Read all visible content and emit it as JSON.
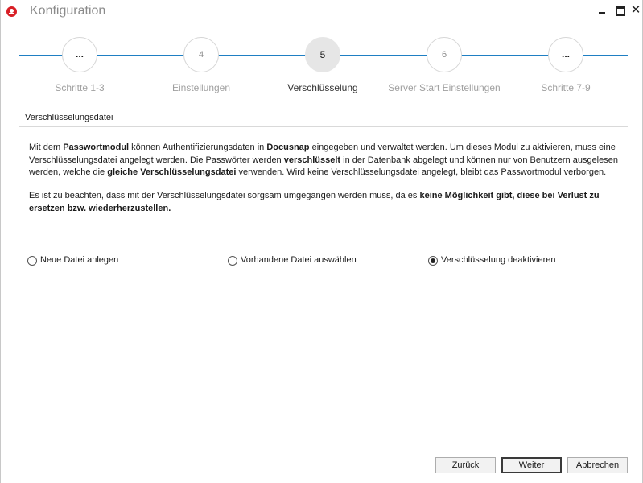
{
  "window": {
    "title": "Konfiguration",
    "close_glyph": "✕"
  },
  "stepper": {
    "steps": [
      {
        "number": "...",
        "label": "Schritte 1-3"
      },
      {
        "number": "4",
        "label": "Einstellungen"
      },
      {
        "number": "5",
        "label": "Verschlüsselung"
      },
      {
        "number": "6",
        "label": "Server Start Einstellungen"
      },
      {
        "number": "...",
        "label": "Schritte 7-9"
      }
    ],
    "active_index": 2,
    "accent_color": "#1f7fc3"
  },
  "section": {
    "title": "Verschlüsselungsdatei"
  },
  "paragraph1": {
    "t1": "Mit dem ",
    "b1": "Passwortmodul",
    "t2": " können Authentifizierungsdaten in ",
    "b2": "Docusnap",
    "t3": " eingegeben und verwaltet werden. Um dieses Modul zu aktivieren, muss eine Verschlüsselungsdatei angelegt werden. Die Passwörter werden ",
    "b3": "verschlüsselt",
    "t4": " in der Datenbank abgelegt und können nur von Benutzern ausgelesen werden, welche die ",
    "b4": "gleiche Verschlüsselungsdatei",
    "t5": " verwenden. Wird keine Verschlüsselungsdatei angelegt, bleibt das Passwortmodul verborgen."
  },
  "paragraph2": {
    "t1": "Es ist zu beachten, dass mit der Verschlüsselungsdatei sorgsam umgegangen werden muss, da es ",
    "b1": "keine Möglichkeit gibt, diese bei Verlust zu ersetzen bzw. wiederherzustellen."
  },
  "options": [
    {
      "label": "Neue Datei anlegen",
      "checked": false
    },
    {
      "label": "Vorhandene Datei auswählen",
      "checked": false
    },
    {
      "label": "Verschlüsselung deaktivieren",
      "checked": true
    }
  ],
  "buttons": {
    "back": "Zurück",
    "next": "Weiter",
    "cancel": "Abbrechen"
  }
}
